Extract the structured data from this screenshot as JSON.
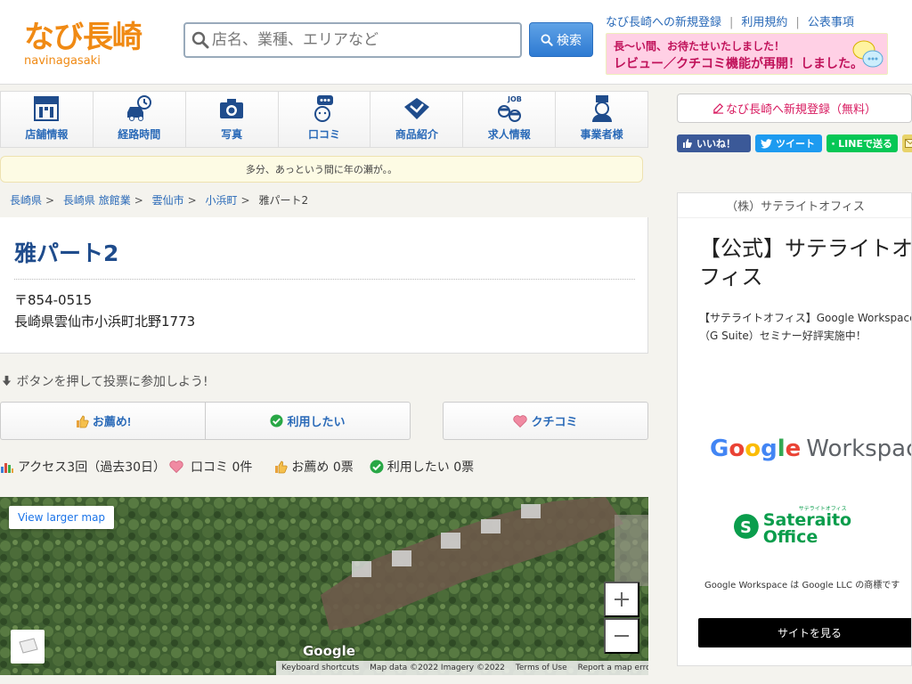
{
  "header": {
    "logo_text": "なび長崎",
    "logo_sub": "navinagasaki",
    "search_placeholder": "店名、業種、エリアなど",
    "search_button": "検索",
    "links": [
      "なび長崎への新規登録",
      "利用規約",
      "公表事項"
    ],
    "banner_line1": "長〜い間、お待たせいたしました！",
    "banner_line2": "レビュー／クチコミ機能が再開！しました。"
  },
  "nav": [
    {
      "label": "店舗情報",
      "icon": "info-icon"
    },
    {
      "label": "経路時間",
      "icon": "car-clock-icon"
    },
    {
      "label": "写真",
      "icon": "camera-icon"
    },
    {
      "label": "口コミ",
      "icon": "comment-icon"
    },
    {
      "label": "商品紹介",
      "icon": "product-icon"
    },
    {
      "label": "求人情報",
      "icon": "job-icon"
    },
    {
      "label": "事業者様",
      "icon": "business-icon"
    }
  ],
  "notice": "多分、あっという間に年の瀬が。。",
  "breadcrumb": [
    "長崎県",
    "長崎県 旅館業",
    "雲仙市",
    "小浜町",
    "雅パート2"
  ],
  "shop": {
    "name": "雅パート2",
    "postal": "〒854-0515",
    "address": "長崎県雲仙市小浜町北野1773"
  },
  "vote": {
    "hint": "ボタンを押して投票に参加しよう!",
    "recommend": "お薦め!",
    "want_to_use": "利用したい",
    "kuchikomi": "クチコミ"
  },
  "stats": {
    "access": "アクセス3回（過去30日）",
    "kuchikomi": "口コミ 0件",
    "recommend": "お薦め 0票",
    "want": "利用したい 0票"
  },
  "map": {
    "larger": "View larger map",
    "google": "Google",
    "footer": [
      "Keyboard shortcuts",
      "Map data ©2022 Imagery ©2022",
      "Terms of Use",
      "Report a map error"
    ]
  },
  "sidebar": {
    "register": "なび長崎へ新規登録（無料）",
    "social": [
      "いいね！",
      "ツイート",
      "LINEで送る"
    ]
  },
  "ad": {
    "sponsor": "（株）サテライトオフィス",
    "title": "【公式】サテライトオフィス",
    "desc": "【サテライトオフィス】Google Workspace（G Suite）セミナー好評実施中！",
    "logo1": "Google Workspace",
    "logo2": "Sateraito Office",
    "logo2_small": "サテライトオフィス",
    "note": "Google Workspace は Google LLC の商標です",
    "cta": "サイトを見る"
  }
}
